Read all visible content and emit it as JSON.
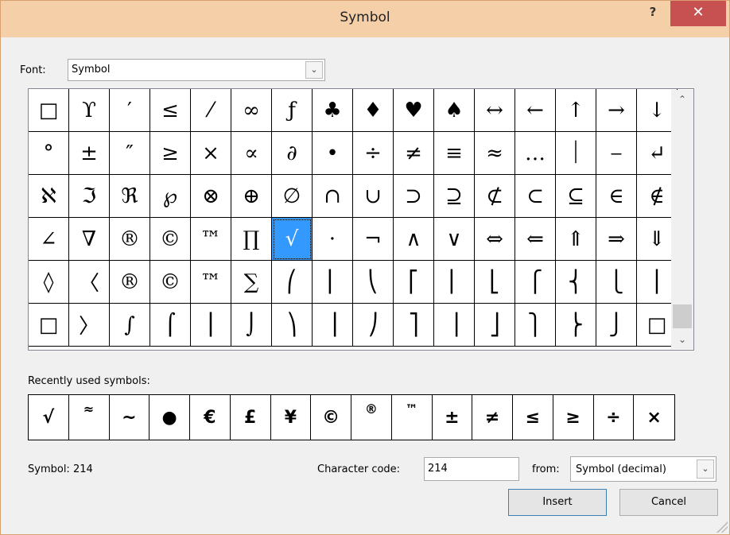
{
  "window": {
    "title": "Symbol",
    "help_label": "?",
    "close_label": "✕"
  },
  "font": {
    "label": "Font:",
    "value": "Symbol",
    "arrow": "⌄"
  },
  "grid": {
    "cells": [
      "□",
      "ϒ",
      "′",
      "≤",
      "⁄",
      "∞",
      "ƒ",
      "♣",
      "♦",
      "♥",
      "♠",
      "↔",
      "←",
      "↑",
      "→",
      "↓",
      "°",
      "±",
      "″",
      "≥",
      "×",
      "∝",
      "∂",
      "•",
      "÷",
      "≠",
      "≡",
      "≈",
      "…",
      "⏐",
      "⎯",
      "↵",
      "ℵ",
      "ℑ",
      "ℜ",
      "℘",
      "⊗",
      "⊕",
      "∅",
      "∩",
      "∪",
      "⊃",
      "⊇",
      "⊄",
      "⊂",
      "⊆",
      "∈",
      "∉",
      "∠",
      "∇",
      "®",
      "©",
      "™",
      "∏",
      "√",
      "⋅",
      "¬",
      "∧",
      "∨",
      "⇔",
      "⇐",
      "⇑",
      "⇒",
      "⇓",
      "◊",
      "〈",
      "®",
      "©",
      "™",
      "∑",
      "⎛",
      "⎜",
      "⎝",
      "⎡",
      "⎢",
      "⎣",
      "⎧",
      "⎨",
      "⎩",
      "⎪",
      "□",
      "〉",
      "∫",
      "⌠",
      "⎮",
      "⌡",
      "⎞",
      "⎟",
      "⎠",
      "⎤",
      "⎥",
      "⎦",
      "⎫",
      "⎬",
      "⎭",
      "□"
    ],
    "selected_index": 54,
    "scroll_up": "⌃",
    "scroll_down": "⌄"
  },
  "recent": {
    "label": "Recently used symbols:",
    "symbols": [
      "√",
      "≈",
      "~",
      "●",
      "€",
      "£",
      "¥",
      "©",
      "®",
      "™",
      "±",
      "≠",
      "≤",
      "≥",
      "÷",
      "×"
    ]
  },
  "status": {
    "symbol_text": "Symbol: 214"
  },
  "char_code": {
    "label": "Character code:",
    "value": "214"
  },
  "from": {
    "label": "from:",
    "value": "Symbol (decimal)",
    "arrow": "⌄"
  },
  "buttons": {
    "insert": "Insert",
    "cancel": "Cancel"
  },
  "colors": {
    "titlebar": "#f5cfa7",
    "close": "#c75050",
    "selection": "#3399ff"
  }
}
